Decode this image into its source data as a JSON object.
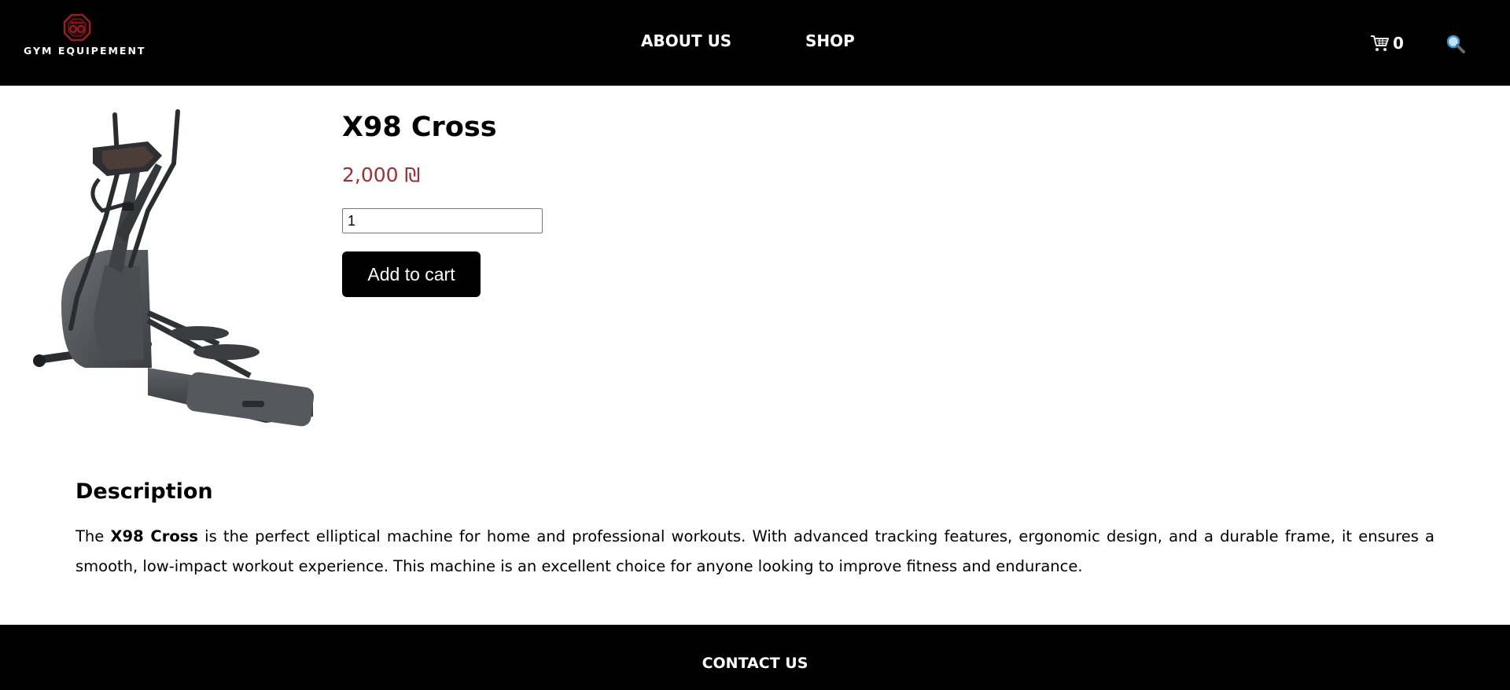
{
  "header": {
    "logo_text": "GYM EQUIPEMENT",
    "nav": {
      "about_label": "ABOUT US",
      "shop_label": "SHOP"
    },
    "cart_count": "0",
    "cart_icon": "cart-icon",
    "search_icon": "search-icon"
  },
  "product": {
    "name": "X98 Cross",
    "price": "2,000 ₪",
    "quantity": "1",
    "add_to_cart_label": "Add to cart",
    "image_alt": "elliptical-machine-image"
  },
  "description": {
    "heading": "Description",
    "text_before": "The ",
    "text_bold": "X98 Cross",
    "text_after": " is the perfect elliptical machine for home and professional workouts. With advanced tracking features, ergonomic design, and a durable frame, it ensures a smooth, low-impact workout experience. This machine is an excellent choice for anyone looking to improve fitness and endurance."
  },
  "footer": {
    "contact_label": "CONTACT US"
  },
  "colors": {
    "header_bg": "#000000",
    "price": "#a03037",
    "logo_accent": "#9e1b25",
    "button_bg": "#000000"
  }
}
